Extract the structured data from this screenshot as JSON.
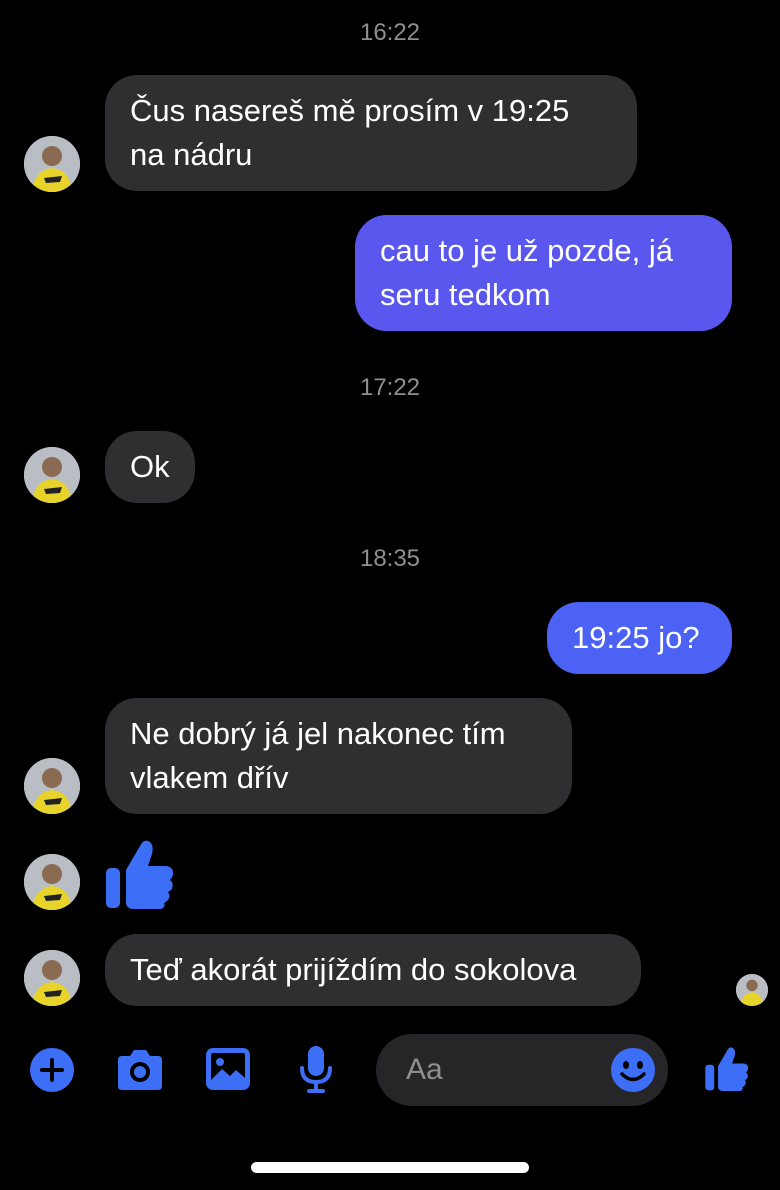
{
  "conversation": {
    "timestamps": [
      "16:22",
      "17:22",
      "18:35"
    ],
    "messages": [
      {
        "sender": "contact",
        "lines": [
          "Čus nasereš mě prosím v 19:25",
          "na nádru"
        ]
      },
      {
        "sender": "me",
        "lines": [
          "cau to je už pozde, já",
          "seru tedkom"
        ]
      },
      {
        "sender": "contact",
        "lines": [
          "Ok"
        ]
      },
      {
        "sender": "me",
        "lines": [
          "19:25 jo?"
        ]
      },
      {
        "sender": "contact",
        "lines": [
          "Ne dobrý já jel nakonec tím",
          "vlakem dřív"
        ]
      },
      {
        "sender": "contact",
        "type": "like-sticker",
        "icon": "thumbs-up-icon"
      },
      {
        "sender": "contact",
        "lines": [
          "Teď akorát prijíždím do sokolova"
        ]
      }
    ]
  },
  "composer": {
    "placeholder": "Aa",
    "icons": [
      "plus-icon",
      "camera-icon",
      "gallery-icon",
      "microphone-icon",
      "emoji-icon",
      "thumbs-up-icon"
    ]
  },
  "colors": {
    "background": "#000000",
    "incoming_bubble": "#2f2f31",
    "outgoing_bubble_top": "#5c55ee",
    "outgoing_bubble_bottom": "#4a64f5",
    "accent": "#3c6ef6",
    "timestamp": "#8e8e93"
  }
}
